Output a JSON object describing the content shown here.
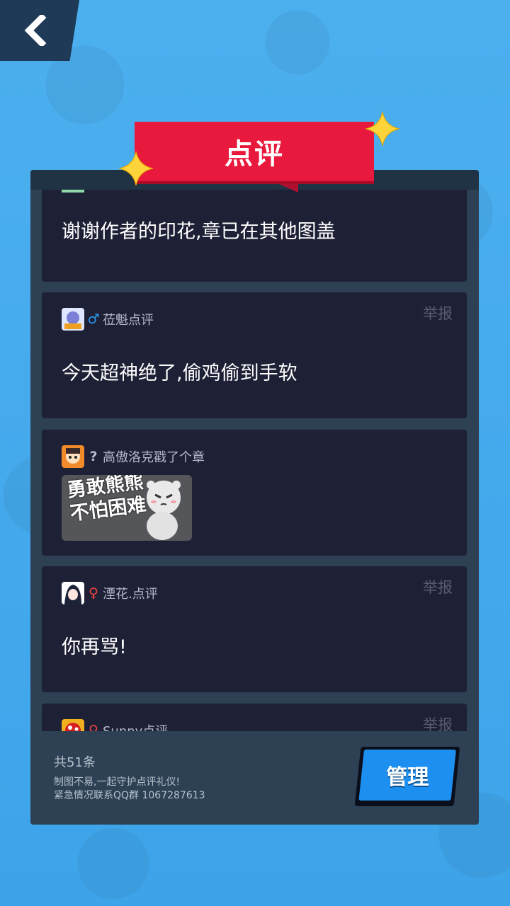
{
  "header": {
    "back_icon": "chevron-left-icon",
    "title": "点评"
  },
  "comments": [
    {
      "text": "谢谢作者的印花,章已在其他图盖"
    },
    {
      "gender": "♂",
      "gender_color": "#2a9cf0",
      "name": "莅魁点评",
      "report_label": "举报",
      "text": "今天超神绝了,偷鸡偷到手软"
    },
    {
      "gender": "?",
      "gender_color": "#b4b7c8",
      "name": "高傲洛克戳了个章",
      "stamp_text": "勇敢熊熊\n不怕困难"
    },
    {
      "gender": "♀",
      "gender_color": "#f04545",
      "name": "湮花.点评",
      "report_label": "举报",
      "text": "你再骂!"
    },
    {
      "gender": "♀",
      "gender_color": "#f04545",
      "name": "Sunny点评",
      "report_label": "举报"
    }
  ],
  "footer": {
    "count": "共51条",
    "notice_line1": "制图不易,一起守护点评礼仪!",
    "notice_line2": "紧急情况联系QQ群 1067287613",
    "manage_label": "管理"
  }
}
